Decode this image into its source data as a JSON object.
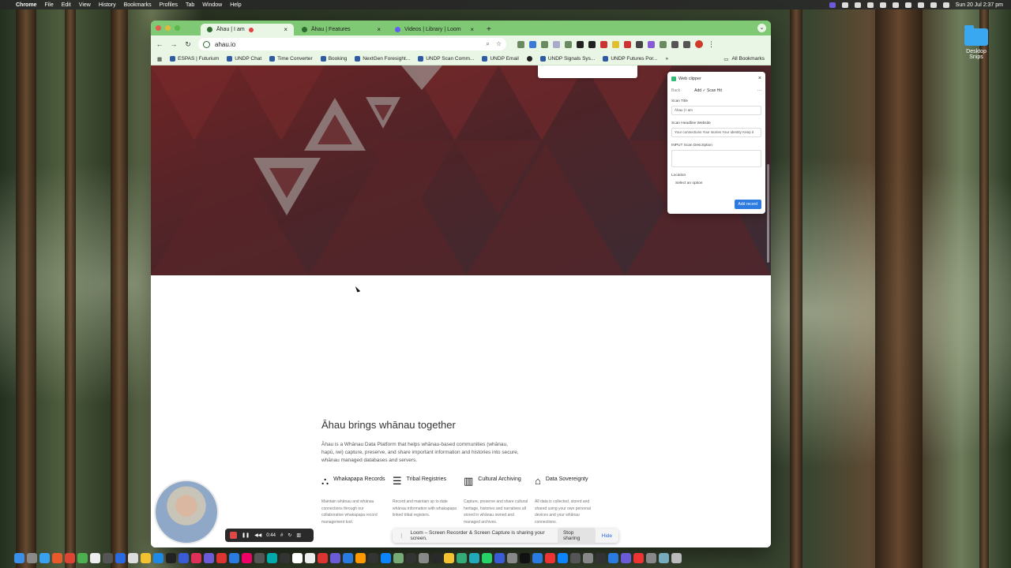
{
  "menubar": {
    "app": "Chrome",
    "items": [
      "File",
      "Edit",
      "View",
      "History",
      "Bookmarks",
      "Profiles",
      "Tab",
      "Window",
      "Help"
    ],
    "clock": "Sun 20 Jul  2:37 pm"
  },
  "desktop": {
    "folder_label": "Desktop Snips"
  },
  "browser": {
    "tabs": [
      {
        "label": "Āhau | I am",
        "active": true
      },
      {
        "label": "Āhau | Features",
        "active": false
      },
      {
        "label": "Videos | Library | Loom",
        "active": false
      }
    ],
    "new_tab": "+",
    "url": "ahau.io",
    "bookmarks": [
      "ESPAS | Futurium",
      "UNDP Chat",
      "Time Converter",
      "Booking",
      "NextGen Foresight...",
      "UNDP Scan Comm...",
      "UNDP Email",
      "UNDP Signals Sys...",
      "UNDP Futures Por..."
    ],
    "all_bookmarks": "All Bookmarks"
  },
  "page": {
    "headline": "Āhau brings whānau together",
    "intro": "Āhau is a Whānau Data Platform that helps whānau-based communities (whānau, hapū, iwi) capture, preserve, and share important information and histories into secure, whānau managed databases and servers.",
    "features": [
      {
        "icon": "tree-icon",
        "glyph": "⛬",
        "title": "Whakapapa Records",
        "desc": "Maintain whānau and whānau connections through our collaborative whakapapa record management tool."
      },
      {
        "icon": "list-icon",
        "glyph": "☰",
        "title": "Tribal Registries",
        "desc": "Record and maintain up to date whānau information with whakapapa linked tribal registers."
      },
      {
        "icon": "books-icon",
        "glyph": "▥",
        "title": "Cultural Archiving",
        "desc": "Capture, preserve and share cultural heritage, histories and narratives all stored in whānau owned and managed archives."
      },
      {
        "icon": "house-icon",
        "glyph": "⌂",
        "title": "Data Sovereignty",
        "desc": "All data is collected, stored and shared using your own personal devices and your whānau connections."
      }
    ]
  },
  "clipper": {
    "title": "Web clipper",
    "back": "Back",
    "mode": "Add ✓ Scan Hit",
    "more": "···",
    "fields": {
      "scan_title_label": "Scan Title",
      "scan_title_value": "Āhau | I am",
      "headline_label": "Scan Headline Website",
      "headline_value": "Your connections Your stories Your identity Keep it",
      "input_desc_label": "INPUT Scan Description",
      "input_desc_value": "",
      "location_label": "Location",
      "location_value": "Select an option"
    },
    "add_button": "Add record"
  },
  "loom": {
    "timer": "0:44",
    "share_text": "Loom – Screen Recorder & Screen Capture is sharing your screen.",
    "stop_sharing": "Stop sharing",
    "hide": "Hide"
  },
  "colors": {
    "chrome_green": "#7fc874",
    "hero_red": "#6e2426",
    "loom_red": "#e04848",
    "clipper_button": "#2d7be0"
  }
}
